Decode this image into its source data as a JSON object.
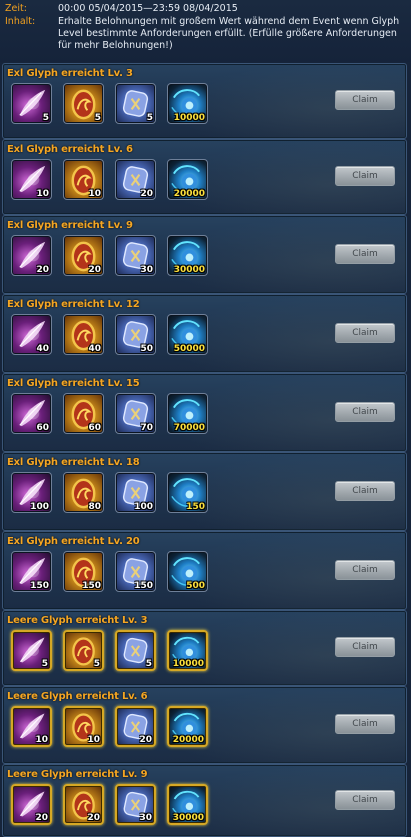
{
  "event_info": {
    "time_label": "Zeit:",
    "time_value": "00:00 05/04/2015—23:59 08/04/2015",
    "content_label": "Inhalt:",
    "content_value": "Erhalte Belohnungen mit großem Wert während dem Event wenn Glyph Level bestimmte Anforderungen erfüllt. (Erfülle größere Anforderungen für mehr Belohnungen!)"
  },
  "claim_label": "Claim",
  "rewards": [
    {
      "title": "Exl Glyph erreicht Lv. 3",
      "items": [
        {
          "icon": "feather-icon",
          "qty": "5"
        },
        {
          "icon": "egg-icon",
          "qty": "5"
        },
        {
          "icon": "rune-icon",
          "qty": "5"
        },
        {
          "icon": "blue-orb-icon",
          "qty": "10000"
        }
      ]
    },
    {
      "title": "Exl Glyph erreicht Lv. 6",
      "items": [
        {
          "icon": "feather-icon",
          "qty": "10"
        },
        {
          "icon": "egg-icon",
          "qty": "10"
        },
        {
          "icon": "rune-icon",
          "qty": "20"
        },
        {
          "icon": "blue-orb-icon",
          "qty": "20000"
        }
      ]
    },
    {
      "title": "Exl Glyph erreicht Lv. 9",
      "items": [
        {
          "icon": "feather-icon",
          "qty": "20"
        },
        {
          "icon": "egg-icon",
          "qty": "20"
        },
        {
          "icon": "rune-icon",
          "qty": "30"
        },
        {
          "icon": "blue-orb-icon",
          "qty": "30000"
        }
      ]
    },
    {
      "title": "Exl Glyph erreicht Lv. 12",
      "items": [
        {
          "icon": "feather-icon",
          "qty": "40"
        },
        {
          "icon": "egg-icon",
          "qty": "40"
        },
        {
          "icon": "rune-icon",
          "qty": "50"
        },
        {
          "icon": "blue-orb-icon",
          "qty": "50000"
        }
      ]
    },
    {
      "title": "Exl Glyph erreicht Lv. 15",
      "items": [
        {
          "icon": "feather-icon",
          "qty": "60"
        },
        {
          "icon": "egg-icon",
          "qty": "60"
        },
        {
          "icon": "rune-icon",
          "qty": "70"
        },
        {
          "icon": "blue-orb-icon",
          "qty": "70000"
        }
      ]
    },
    {
      "title": "Exl Glyph erreicht Lv. 18",
      "items": [
        {
          "icon": "feather-icon",
          "qty": "100"
        },
        {
          "icon": "egg-icon",
          "qty": "80"
        },
        {
          "icon": "rune-icon",
          "qty": "100"
        },
        {
          "icon": "blue-orb-icon",
          "qty": "150"
        }
      ]
    },
    {
      "title": "Exl Glyph erreicht Lv. 20",
      "items": [
        {
          "icon": "feather-icon",
          "qty": "150"
        },
        {
          "icon": "egg-icon",
          "qty": "150"
        },
        {
          "icon": "rune-icon",
          "qty": "150"
        },
        {
          "icon": "blue-orb-icon",
          "qty": "500"
        }
      ]
    },
    {
      "title": "Leere Glyph erreicht Lv. 3",
      "items": [
        {
          "icon": "feather-icon",
          "qty": "5"
        },
        {
          "icon": "egg-icon",
          "qty": "5"
        },
        {
          "icon": "rune-icon",
          "qty": "5"
        },
        {
          "icon": "blue-orb-icon",
          "qty": "10000"
        }
      ]
    },
    {
      "title": "Leere Glyph erreicht Lv. 6",
      "items": [
        {
          "icon": "feather-icon",
          "qty": "10"
        },
        {
          "icon": "egg-icon",
          "qty": "10"
        },
        {
          "icon": "rune-icon",
          "qty": "20"
        },
        {
          "icon": "blue-orb-icon",
          "qty": "20000"
        }
      ]
    },
    {
      "title": "Leere Glyph erreicht Lv. 9",
      "items": [
        {
          "icon": "feather-icon",
          "qty": "20"
        },
        {
          "icon": "egg-icon",
          "qty": "20"
        },
        {
          "icon": "rune-icon",
          "qty": "30"
        },
        {
          "icon": "blue-orb-icon",
          "qty": "30000"
        }
      ]
    }
  ]
}
